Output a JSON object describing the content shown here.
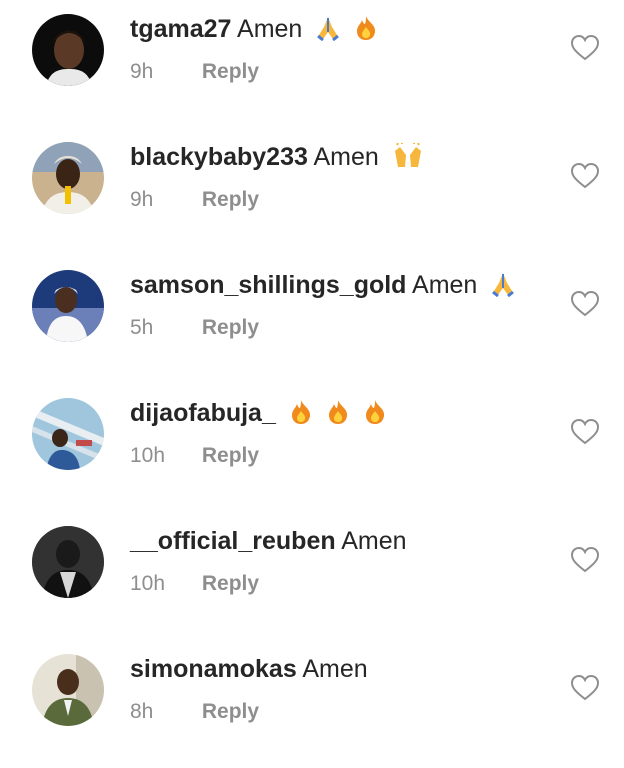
{
  "comments": [
    {
      "username": "tgama27",
      "text": "Amen",
      "emojis": [
        "folded-hands",
        "fire"
      ],
      "time": "9h",
      "reply_label": "Reply",
      "avatar": "avatar-tgama27"
    },
    {
      "username": "blackybaby233",
      "text": "Amen",
      "emojis": [
        "raising-hands"
      ],
      "time": "9h",
      "reply_label": "Reply",
      "avatar": "avatar-blackybaby233"
    },
    {
      "username": "samson_shillings_gold",
      "text": "Amen",
      "emojis": [
        "folded-hands"
      ],
      "time": "5h",
      "reply_label": "Reply",
      "avatar": "avatar-samson"
    },
    {
      "username": "dijaofabuja_",
      "text": "",
      "emojis": [
        "fire",
        "fire",
        "fire"
      ],
      "time": "10h",
      "reply_label": "Reply",
      "avatar": "avatar-dijaofabuja"
    },
    {
      "username": "__official_reuben",
      "text": "Amen",
      "emojis": [],
      "time": "10h",
      "reply_label": "Reply",
      "avatar": "avatar-reuben"
    },
    {
      "username": "simonamokas",
      "text": "Amen",
      "emojis": [],
      "time": "8h",
      "reply_label": "Reply",
      "avatar": "avatar-simonamokas"
    }
  ],
  "colors": {
    "text": "#262626",
    "meta": "#8e8e8e",
    "heart": "#8e8e8e",
    "background": "#ffffff"
  }
}
